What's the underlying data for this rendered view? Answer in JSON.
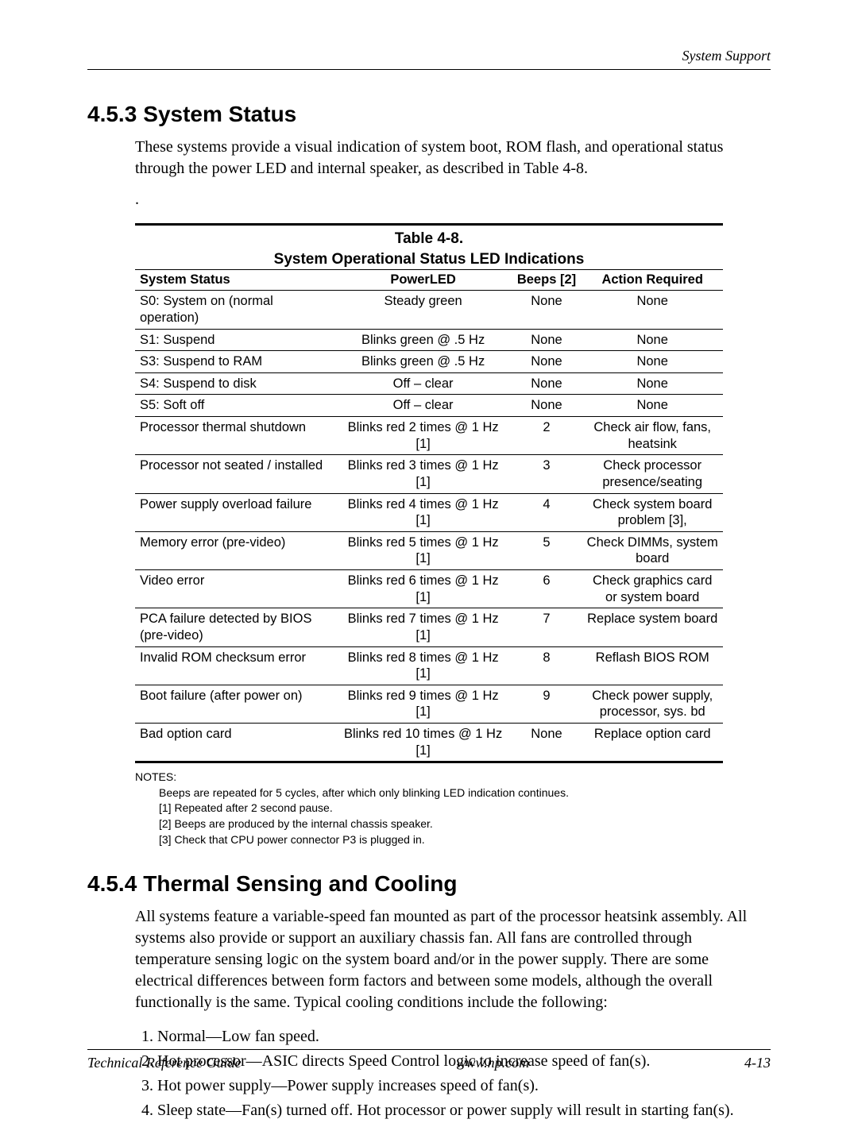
{
  "header": {
    "right": "System Support"
  },
  "section1": {
    "number": "4.5.3",
    "title": "System Status",
    "paragraph": "These systems provide a visual indication of system boot, ROM flash, and operational status through the power LED and internal speaker, as described in Table 4-8."
  },
  "table": {
    "caption_line1": "Table 4-8.",
    "caption_line2": "System Operational Status LED Indications",
    "headers": {
      "ss": "System Status",
      "pl": "PowerLED",
      "bp": "Beeps [2]",
      "ar": "Action Required"
    },
    "rows": [
      {
        "ss": "S0: System on (normal operation)",
        "pl": "Steady green",
        "bp": "None",
        "ar": "None"
      },
      {
        "ss": "S1: Suspend",
        "pl": "Blinks green @ .5 Hz",
        "bp": "None",
        "ar": "None"
      },
      {
        "ss": "S3: Suspend to RAM",
        "pl": "Blinks green @ .5 Hz",
        "bp": "None",
        "ar": "None"
      },
      {
        "ss": "S4: Suspend to disk",
        "pl": "Off – clear",
        "bp": "None",
        "ar": "None"
      },
      {
        "ss": "S5: Soft off",
        "pl": "Off – clear",
        "bp": "None",
        "ar": "None"
      },
      {
        "ss": "Processor thermal shutdown",
        "pl": "Blinks red 2 times @ 1 Hz [1]",
        "bp": "2",
        "ar": "Check air flow, fans, heatsink"
      },
      {
        "ss": "Processor not seated / installed",
        "pl": "Blinks red 3 times @ 1 Hz [1]",
        "bp": "3",
        "ar": "Check processor presence/seating"
      },
      {
        "ss": "Power supply overload failure",
        "pl": "Blinks red 4 times @ 1 Hz [1]",
        "bp": "4",
        "ar": "Check system board problem [3],"
      },
      {
        "ss": "Memory error (pre-video)",
        "pl": "Blinks red 5 times @ 1 Hz [1]",
        "bp": "5",
        "ar": "Check DIMMs, system board"
      },
      {
        "ss": "Video error",
        "pl": "Blinks red 6 times @ 1 Hz [1]",
        "bp": "6",
        "ar": "Check graphics card or system board"
      },
      {
        "ss": "PCA failure detected by BIOS (pre-video)",
        "pl": "Blinks red 7 times @ 1 Hz [1]",
        "bp": "7",
        "ar": "Replace system board"
      },
      {
        "ss": "Invalid ROM checksum error",
        "pl": "Blinks red 8 times @ 1 Hz [1]",
        "bp": "8",
        "ar": "Reflash BIOS ROM"
      },
      {
        "ss": "Boot failure (after power on)",
        "pl": "Blinks red 9 times @ 1 Hz [1]",
        "bp": "9",
        "ar": "Check power supply, processor, sys. bd"
      },
      {
        "ss": "Bad option card",
        "pl": "Blinks red 10 times @ 1 Hz [1]",
        "bp": "None",
        "ar": "Replace option card"
      }
    ]
  },
  "notes": {
    "lead": "NOTES:",
    "items": [
      "Beeps are repeated for 5 cycles, after which only blinking LED indication continues.",
      "[1] Repeated after 2 second pause.",
      "[2] Beeps are produced by the internal chassis speaker.",
      "[3] Check that CPU power connector P3 is plugged in."
    ]
  },
  "section2": {
    "number": "4.5.4",
    "title": "Thermal Sensing and Cooling",
    "paragraph": "All systems feature a variable-speed fan mounted as part of the processor heatsink assembly. All systems also provide or support an auxiliary chassis fan. All fans are controlled through temperature sensing logic on the system board and/or in the power supply. There are some electrical differences between form factors and between some models, although the overall functionally is the same. Typical cooling conditions include the following:",
    "list": [
      "Normal—Low fan speed.",
      "Hot processor—ASIC directs Speed Control logic to increase speed of fan(s).",
      "Hot power supply—Power supply increases speed of fan(s).",
      "Sleep state—Fan(s) turned off. Hot processor or power supply will result in starting fan(s)."
    ]
  },
  "footer": {
    "left": "Technical Reference Guide",
    "center": "www.hp.com",
    "right": "4-13"
  }
}
